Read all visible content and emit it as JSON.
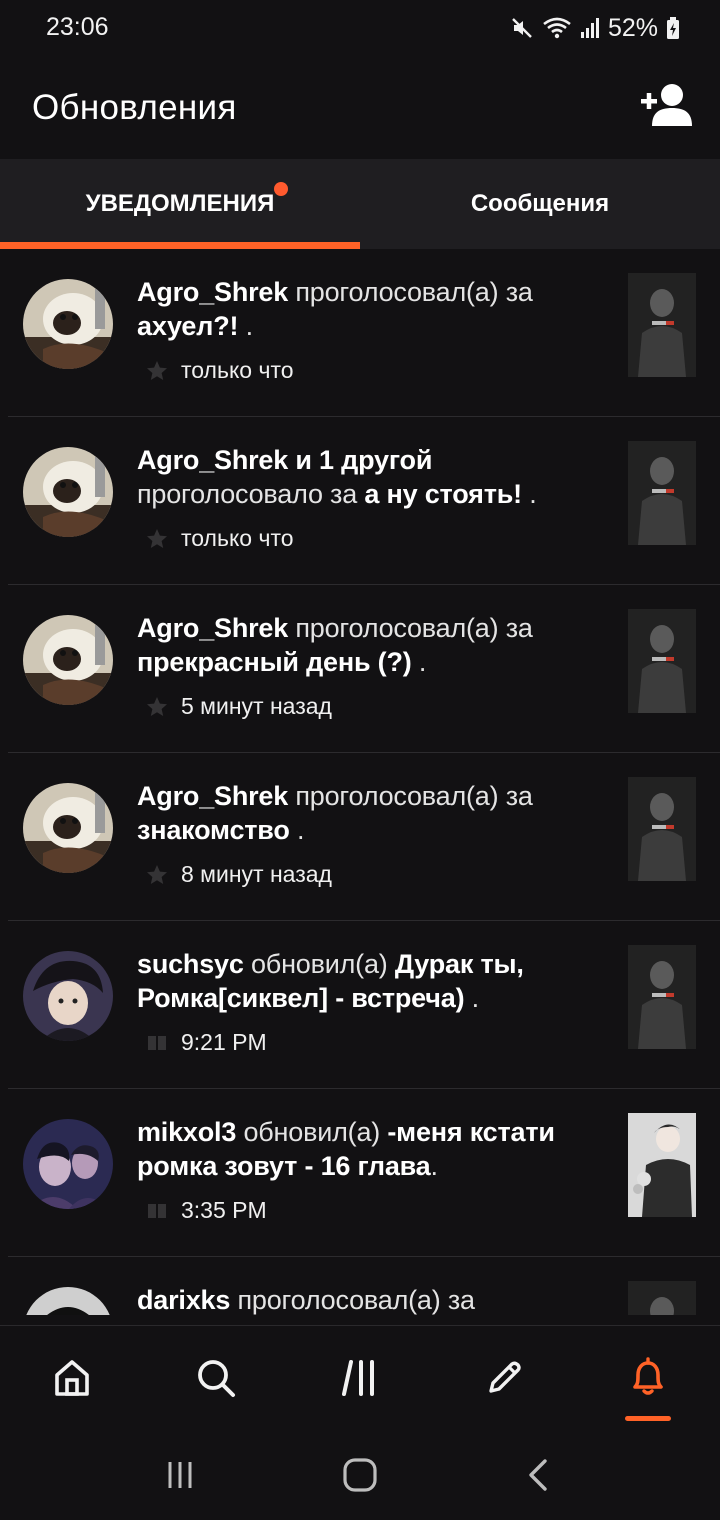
{
  "status_bar": {
    "time": "23:06",
    "battery": "52%",
    "icons": [
      "mute-icon",
      "wifi-icon",
      "signal-icon",
      "battery-charging-icon"
    ]
  },
  "header": {
    "title": "Обновления",
    "action_icon": "add-friend-icon"
  },
  "tabs": [
    {
      "label": "УВЕДОМЛЕНИЯ",
      "active": true,
      "has_badge": true
    },
    {
      "label": "Сообщения",
      "active": false,
      "has_badge": false
    }
  ],
  "accent_color": "#ff6227",
  "notifications": [
    {
      "user": "Agro_Shrek",
      "action": "проголосовал(а) за",
      "target": "ахуел?!",
      "suffix": " .",
      "time": "только что",
      "time_icon": "star-icon"
    },
    {
      "user": "Agro_Shrek и 1 другой",
      "action": "проголосовало за",
      "target": "а ну стоять!",
      "suffix": " .",
      "time": "только что",
      "time_icon": "star-icon"
    },
    {
      "user": "Agro_Shrek",
      "action": "проголосовал(а) за",
      "target": "прекрасный день (?)",
      "suffix": " .",
      "time": "5 минут назад",
      "time_icon": "star-icon"
    },
    {
      "user": "Agro_Shrek",
      "action": "проголосовал(а) за",
      "target": "знакомство",
      "suffix": " .",
      "time": "8 минут назад",
      "time_icon": "star-icon"
    },
    {
      "user": "suchsyc",
      "action": "обновил(а)",
      "target": "Дурак ты, Ромка[сиквел] - встреча)",
      "suffix": " .",
      "time": "9:21 PM",
      "time_icon": "book-icon"
    },
    {
      "user": "mikxol3",
      "action": "обновил(а)",
      "target": "-меня кстати ромка зовут - 16 глава",
      "suffix": ".",
      "time": "3:35 PM",
      "time_icon": "book-icon"
    },
    {
      "user": "darixks",
      "action": "проголосовал(а) за",
      "target": "",
      "suffix": "",
      "time": "",
      "time_icon": "star-icon"
    }
  ],
  "bottom_nav": [
    {
      "name": "home-icon",
      "active": false
    },
    {
      "name": "search-icon",
      "active": false
    },
    {
      "name": "library-icon",
      "active": false
    },
    {
      "name": "write-icon",
      "active": false
    },
    {
      "name": "notifications-bell-icon",
      "active": true
    }
  ],
  "system_nav": [
    "recents-icon",
    "home-circle-icon",
    "back-icon"
  ]
}
